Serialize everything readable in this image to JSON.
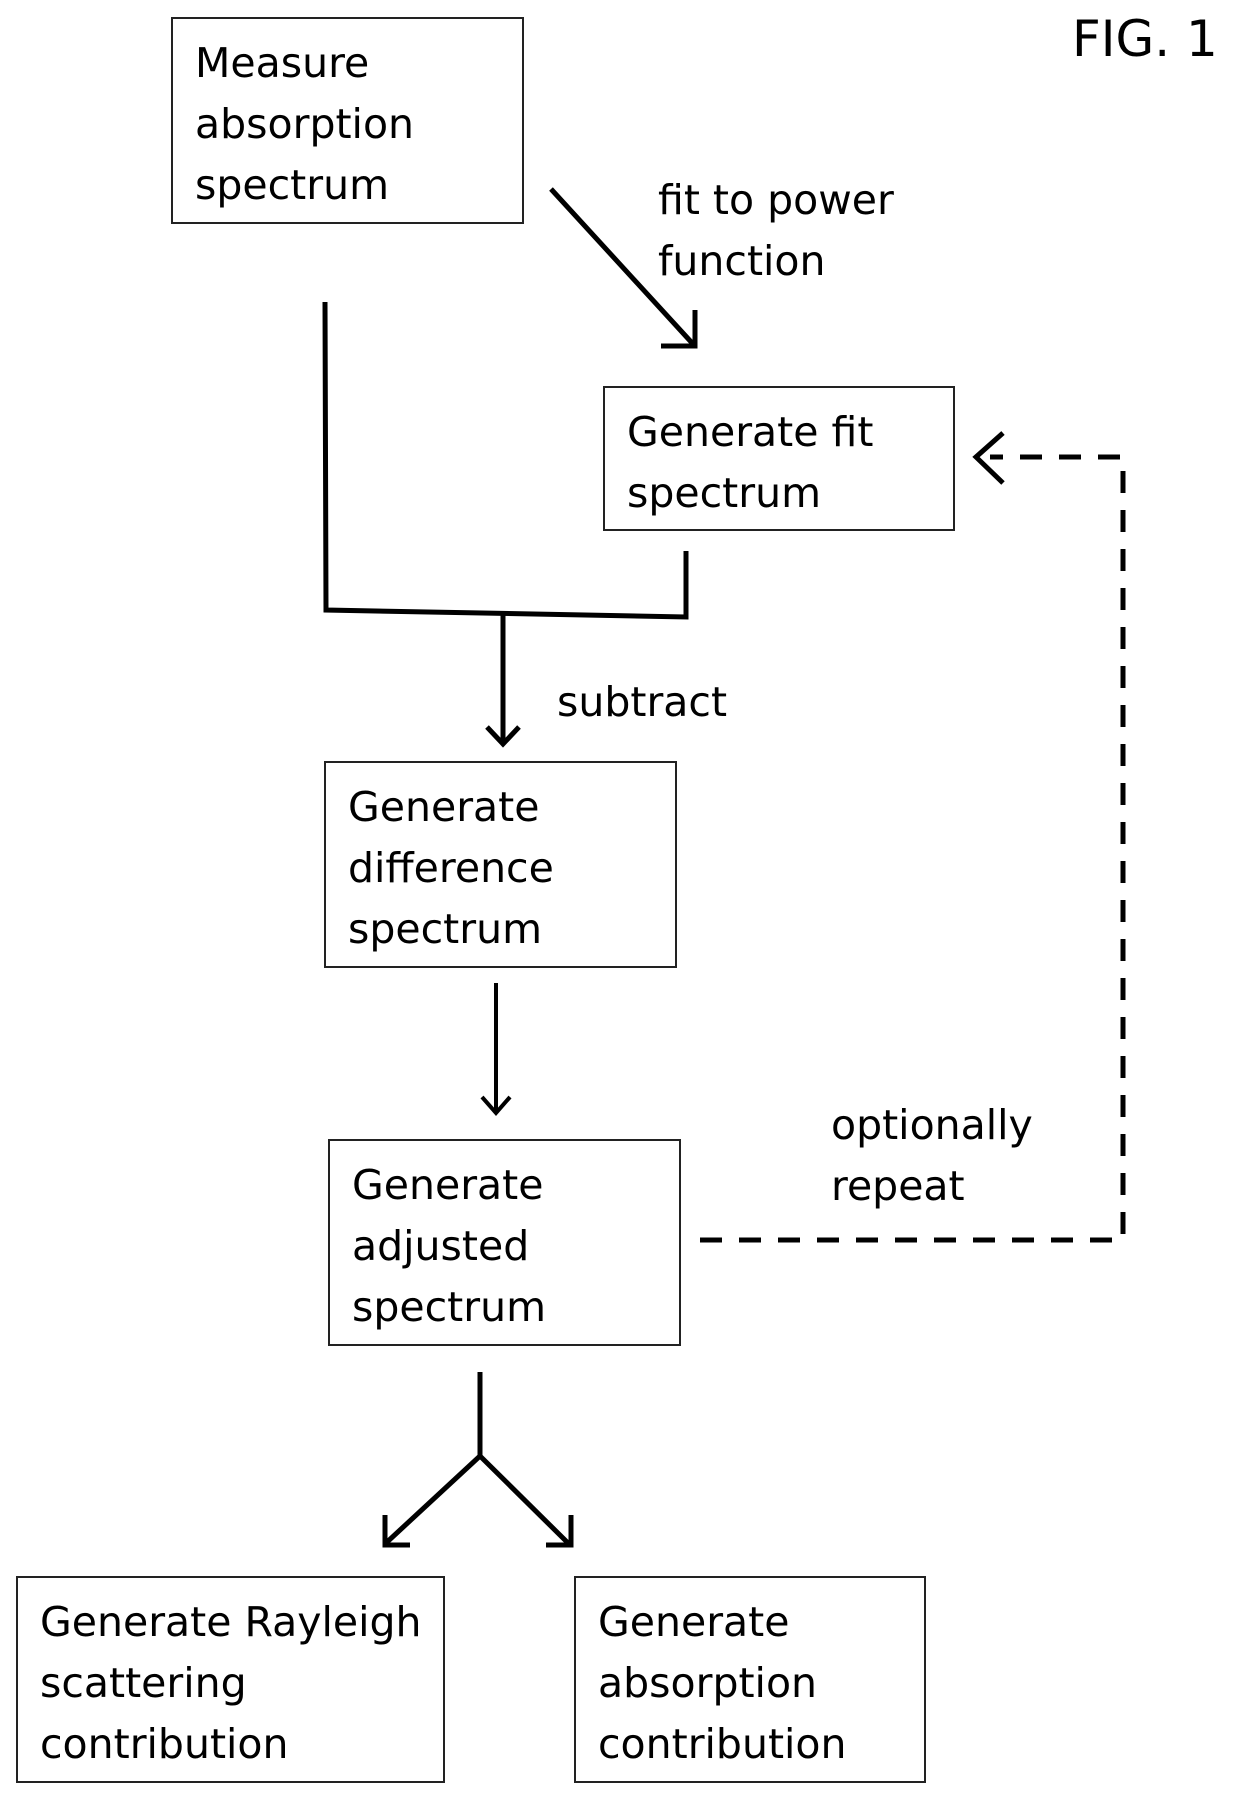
{
  "figure_label": "FIG. 1",
  "boxes": {
    "measure": {
      "lines": [
        "Measure",
        "absorption",
        "spectrum"
      ]
    },
    "fit": {
      "lines": [
        "Generate fit",
        "spectrum"
      ]
    },
    "difference": {
      "lines": [
        "Generate",
        "difference",
        "spectrum"
      ]
    },
    "adjusted": {
      "lines": [
        "Generate",
        "adjusted",
        "spectrum"
      ]
    },
    "rayleigh": {
      "lines": [
        "Generate Rayleigh",
        "scattering",
        "contribution"
      ]
    },
    "absorption": {
      "lines": [
        "Generate",
        "absorption",
        "contribution"
      ]
    }
  },
  "edge_labels": {
    "fit_power": [
      "fit to power",
      "function"
    ],
    "subtract": "subtract",
    "repeat": [
      "optionally",
      "repeat"
    ]
  }
}
